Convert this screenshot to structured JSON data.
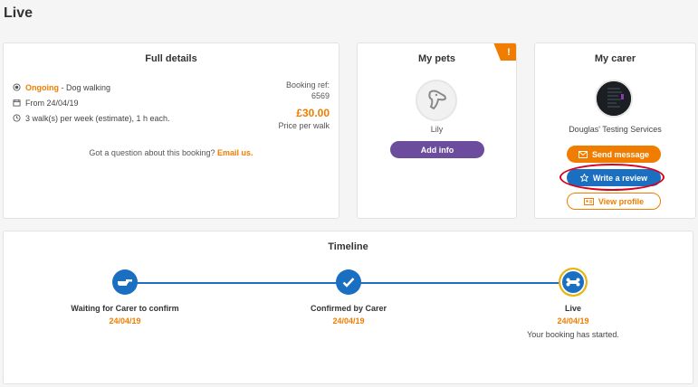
{
  "page": {
    "title": "Live"
  },
  "details": {
    "title": "Full details",
    "status": "Ongoing",
    "service": "- Dog walking",
    "from": "From 24/04/19",
    "frequency": "3 walk(s) per week (estimate), 1 h each.",
    "ref_label": "Booking ref:",
    "ref_value": "6569",
    "price": "£30.00",
    "price_unit": "Price per walk",
    "question": "Got a question about this booking?",
    "email_link": "Email us."
  },
  "pets": {
    "title": "My pets",
    "badge": "!",
    "pet_name": "Lily",
    "add_info": "Add info"
  },
  "carer": {
    "title": "My carer",
    "name": "Douglas' Testing Services",
    "send_message": "Send message",
    "write_review": "Write a review",
    "view_profile": "View profile"
  },
  "timeline": {
    "title": "Timeline",
    "steps": [
      {
        "label": "Waiting for Carer to confirm",
        "date": "24/04/19",
        "icon": "hand-point-icon"
      },
      {
        "label": "Confirmed by Carer",
        "date": "24/04/19",
        "icon": "check-icon"
      },
      {
        "label": "Live",
        "date": "24/04/19",
        "note": "Your booking has started.",
        "icon": "bone-icon"
      }
    ]
  },
  "colors": {
    "accent": "#f07d00",
    "primary": "#1a6fc0",
    "purple": "#6c4c9d",
    "highlight": "#d9001b"
  }
}
